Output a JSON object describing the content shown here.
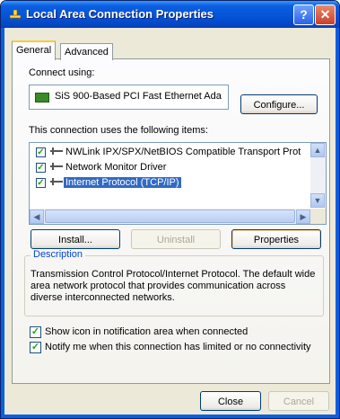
{
  "window": {
    "title": "Local Area Connection Properties",
    "help_label": "?",
    "close_label": "✕"
  },
  "tabs": [
    {
      "label": "General",
      "selected": true
    },
    {
      "label": "Advanced",
      "selected": false
    }
  ],
  "connect": {
    "label": "Connect using:",
    "adapter": "SiS 900-Based PCI Fast Ethernet Ada",
    "configure_label": "Configure..."
  },
  "components": {
    "label": "This connection uses the following items:",
    "items": [
      {
        "label": "NWLink IPX/SPX/NetBIOS Compatible Transport Prot",
        "checked": true
      },
      {
        "label": "Network Monitor Driver",
        "checked": true
      },
      {
        "label": "Internet Protocol (TCP/IP)",
        "checked": true,
        "selected": true
      }
    ]
  },
  "buttons": {
    "install": "Install...",
    "uninstall": "Uninstall",
    "properties": "Properties",
    "close": "Close",
    "cancel": "Cancel"
  },
  "description": {
    "legend": "Description",
    "text": "Transmission Control Protocol/Internet Protocol. The default wide area network protocol that provides communication across diverse interconnected networks."
  },
  "options": [
    {
      "label": "Show icon in notification area when connected",
      "checked": true
    },
    {
      "label": "Notify me when this connection has limited or no connectivity",
      "checked": true
    }
  ],
  "glyphs": {
    "check": "✓",
    "up": "▲",
    "down": "▼",
    "left": "◀",
    "right": "▶"
  }
}
